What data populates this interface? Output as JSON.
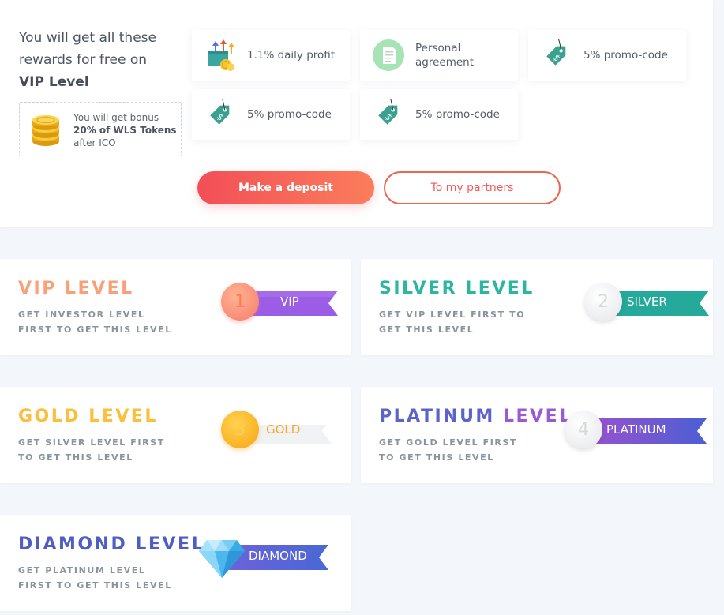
{
  "rewards": {
    "title_line": "You will get all these rewards for free on",
    "title_level": "VIP Level",
    "bonus": {
      "line1": "You will get bonus",
      "line2": "20% of WLS Tokens",
      "line3": "after ICO"
    },
    "items": [
      {
        "label": "1.1% daily profit",
        "icon": "profit-icon"
      },
      {
        "label": "Personal agreement",
        "icon": "document-icon"
      },
      {
        "label": "5% promo-code",
        "icon": "price-tag-icon"
      },
      {
        "label": "5% promo-code",
        "icon": "price-tag-icon"
      },
      {
        "label": "5% promo-code",
        "icon": "price-tag-icon"
      }
    ],
    "deposit_label": "Make a deposit",
    "partners_label": "To my partners"
  },
  "levels": [
    {
      "title_a": "VIP",
      "title_b": "LEVEL",
      "desc": "GET INVESTOR LEVEL FIRST TO GET THIS LEVEL",
      "badge_num": "1",
      "badge_label": "VIP",
      "color": "#f9a07a"
    },
    {
      "title_a": "SILVER",
      "title_b": "LEVEL",
      "desc": "GET VIP LEVEL FIRST TO GET THIS LEVEL",
      "badge_num": "2",
      "badge_label": "SILVER",
      "color": "#2bb6a0"
    },
    {
      "title_a": "GOLD",
      "title_b": "LEVEL",
      "desc": "GET SILVER LEVEL FIRST TO GET THIS LEVEL",
      "badge_num": "3",
      "badge_label": "GOLD",
      "color": "#fbbf3c"
    },
    {
      "title_a": "PLATINUM",
      "title_b": "LEVEL",
      "desc": "GET GOLD LEVEL FIRST TO GET THIS LEVEL",
      "badge_num": "4",
      "badge_label": "PLATINUM",
      "color": "#5c63c9"
    },
    {
      "title_a": "DIAMOND",
      "title_b": "LEVEL",
      "desc": "GET PLATINUM LEVEL FIRST TO GET THIS LEVEL",
      "badge_num": "",
      "badge_label": "DIAMOND",
      "color": "#4f5ec4"
    }
  ],
  "colors": {
    "accent_red": "#f24f57",
    "accent_orange": "#fb7d5b",
    "teal": "#2bb6a0",
    "purple": "#8b56d6"
  }
}
